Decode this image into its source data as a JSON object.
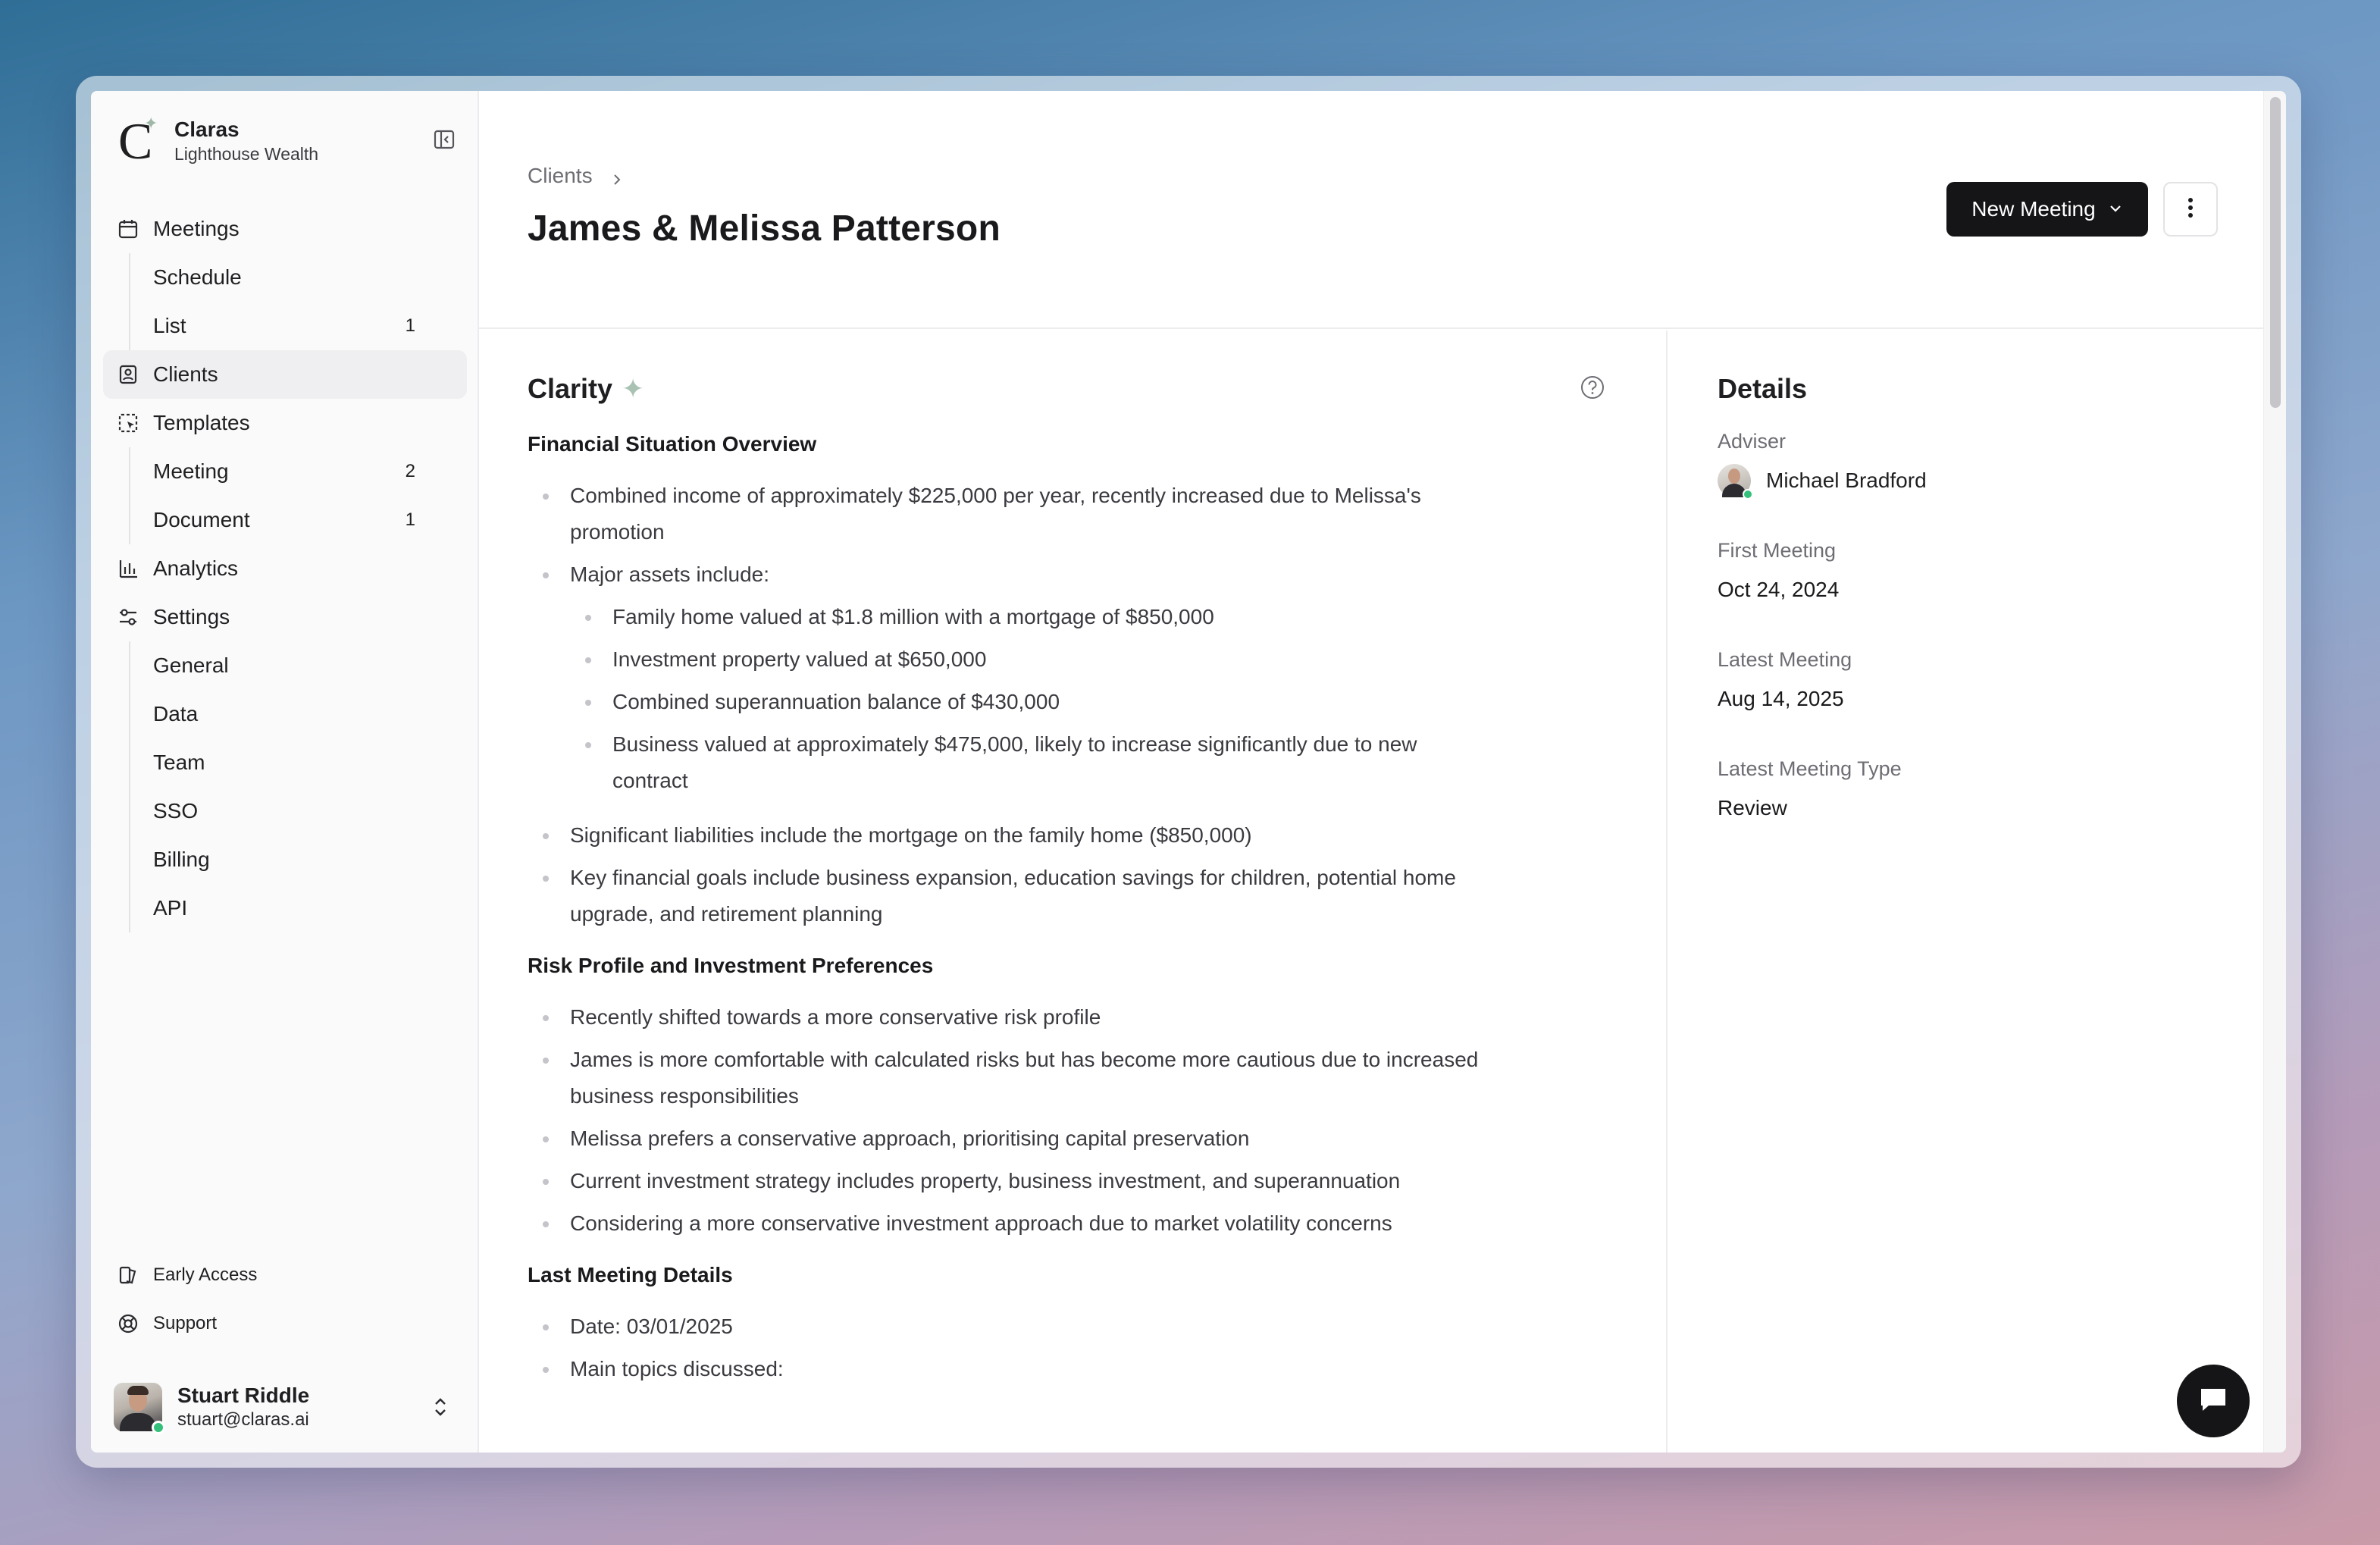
{
  "brand": {
    "name": "Claras",
    "org": "Lighthouse Wealth"
  },
  "sidebar": {
    "meetings": {
      "label": "Meetings",
      "items": [
        {
          "label": "Schedule",
          "count": ""
        },
        {
          "label": "List",
          "count": "1"
        }
      ]
    },
    "clients": {
      "label": "Clients"
    },
    "templates": {
      "label": "Templates",
      "items": [
        {
          "label": "Meeting",
          "count": "2"
        },
        {
          "label": "Document",
          "count": "1"
        }
      ]
    },
    "analytics": {
      "label": "Analytics"
    },
    "settings": {
      "label": "Settings",
      "items": [
        {
          "label": "General"
        },
        {
          "label": "Data"
        },
        {
          "label": "Team"
        },
        {
          "label": "SSO"
        },
        {
          "label": "Billing"
        },
        {
          "label": "API"
        }
      ]
    },
    "bottom": {
      "early_access": "Early Access",
      "support": "Support"
    },
    "user": {
      "name": "Stuart Riddle",
      "email": "stuart@claras.ai"
    }
  },
  "header": {
    "breadcrumb": "Clients",
    "title": "James & Melissa Patterson",
    "new_meeting_label": "New Meeting"
  },
  "clarity": {
    "title": "Clarity",
    "sections": [
      {
        "heading": "Financial Situation Overview",
        "items": [
          "Combined income of approximately $225,000 per year, recently increased due to Melissa's promotion",
          "Major assets include:",
          "Significant liabilities include the mortgage on the family home ($850,000)",
          "Key financial goals include business expansion, education savings for children, potential home upgrade, and retirement planning"
        ],
        "assets": [
          "Family home valued at $1.8 million with a mortgage of $850,000",
          "Investment property valued at $650,000",
          "Combined superannuation balance of $430,000",
          "Business valued at approximately $475,000, likely to increase significantly due to new contract"
        ]
      },
      {
        "heading": "Risk Profile and Investment Preferences",
        "items": [
          "Recently shifted towards a more conservative risk profile",
          "James is more comfortable with calculated risks but has become more cautious due to increased business responsibilities",
          "Melissa prefers a conservative approach, prioritising capital preservation",
          "Current investment strategy includes property, business investment, and superannuation",
          "Considering a more conservative investment approach due to market volatility concerns"
        ]
      },
      {
        "heading": "Last Meeting Details",
        "items": [
          "Date: 03/01/2025",
          "Main topics discussed:"
        ]
      }
    ]
  },
  "details": {
    "title": "Details",
    "adviser_label": "Adviser",
    "adviser_name": "Michael Bradford",
    "first_meeting_label": "First Meeting",
    "first_meeting_value": "Oct 24, 2024",
    "latest_meeting_label": "Latest Meeting",
    "latest_meeting_value": "Aug 14, 2025",
    "latest_type_label": "Latest Meeting Type",
    "latest_type_value": "Review"
  },
  "colors": {
    "accent_dark": "#151517",
    "online": "#34c07a",
    "spark": "#a9c2b3"
  }
}
